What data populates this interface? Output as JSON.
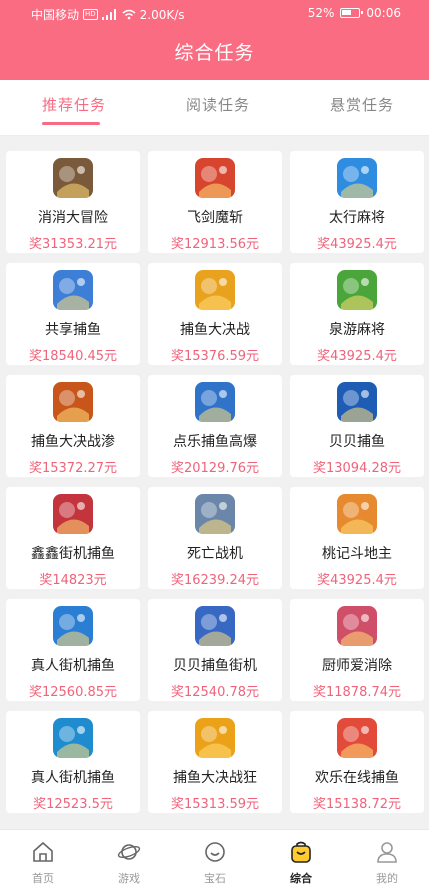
{
  "status_bar": {
    "carrier": "中国移动",
    "hd": "HD",
    "signal": "4G",
    "speed": "2.00K/s",
    "battery": "52%",
    "time": "00:06"
  },
  "header": {
    "title": "综合任务"
  },
  "tabs": [
    {
      "label": "推荐任务"
    },
    {
      "label": "阅读任务"
    },
    {
      "label": "悬赏任务"
    }
  ],
  "tasks": [
    {
      "name": "消消大冒险",
      "reward": "奖31353.21元",
      "icon": "game-adventure-icon",
      "color": "#7a5a3a"
    },
    {
      "name": "飞剑魔斩",
      "reward": "奖12913.56元",
      "icon": "game-swordsman-icon",
      "color": "#d8452f"
    },
    {
      "name": "太行麻将",
      "reward": "奖43925.4元",
      "icon": "game-mahjong-icon",
      "color": "#2e8de0"
    },
    {
      "name": "共享捕鱼",
      "reward": "奖18540.45元",
      "icon": "game-fish-icon",
      "color": "#3d7fd6"
    },
    {
      "name": "捕鱼大决战",
      "reward": "奖15376.59元",
      "icon": "game-fish-icon",
      "color": "#e9a21d"
    },
    {
      "name": "泉游麻将",
      "reward": "奖43925.4元",
      "icon": "game-mahjong-icon",
      "color": "#4aa63a"
    },
    {
      "name": "捕鱼大决战渗",
      "reward": "奖15372.27元",
      "icon": "game-fish-icon",
      "color": "#c8561b"
    },
    {
      "name": "点乐捕鱼高爆",
      "reward": "奖20129.76元",
      "icon": "game-fish-icon",
      "color": "#2f74c9"
    },
    {
      "name": "贝贝捕鱼",
      "reward": "奖13094.28元",
      "icon": "game-fish-icon",
      "color": "#1f5db5"
    },
    {
      "name": "鑫鑫街机捕鱼",
      "reward": "奖14823元",
      "icon": "game-fish-icon",
      "color": "#c4343c"
    },
    {
      "name": "死亡战机",
      "reward": "奖16239.24元",
      "icon": "game-jet-icon",
      "color": "#6a86a8"
    },
    {
      "name": "桃记斗地主",
      "reward": "奖43925.4元",
      "icon": "game-cards-icon",
      "color": "#e7892f"
    },
    {
      "name": "真人街机捕鱼",
      "reward": "奖12560.85元",
      "icon": "game-fish-icon",
      "color": "#2a7ed4"
    },
    {
      "name": "贝贝捕鱼街机",
      "reward": "奖12540.78元",
      "icon": "game-fish-icon",
      "color": "#3769c4"
    },
    {
      "name": "厨师爱消除",
      "reward": "奖11878.74元",
      "icon": "game-chef-icon",
      "color": "#d04f68"
    },
    {
      "name": "真人街机捕鱼",
      "reward": "奖12523.5元",
      "icon": "game-fish-icon",
      "color": "#1f8ccf"
    },
    {
      "name": "捕鱼大决战狂",
      "reward": "奖15313.59元",
      "icon": "game-fish-icon",
      "color": "#eba218"
    },
    {
      "name": "欢乐在线捕鱼",
      "reward": "奖15138.72元",
      "icon": "game-fish-icon",
      "color": "#e24a3a"
    }
  ],
  "navbar": [
    {
      "label": "首页",
      "icon": "home-icon"
    },
    {
      "label": "游戏",
      "icon": "planet-icon"
    },
    {
      "label": "宝石",
      "icon": "smile-icon"
    },
    {
      "label": "综合",
      "icon": "bag-icon"
    },
    {
      "label": "我的",
      "icon": "user-icon"
    }
  ],
  "colors": {
    "brand": "#f96c82",
    "reward": "#f0637a",
    "active_tab": "#f86c83"
  }
}
